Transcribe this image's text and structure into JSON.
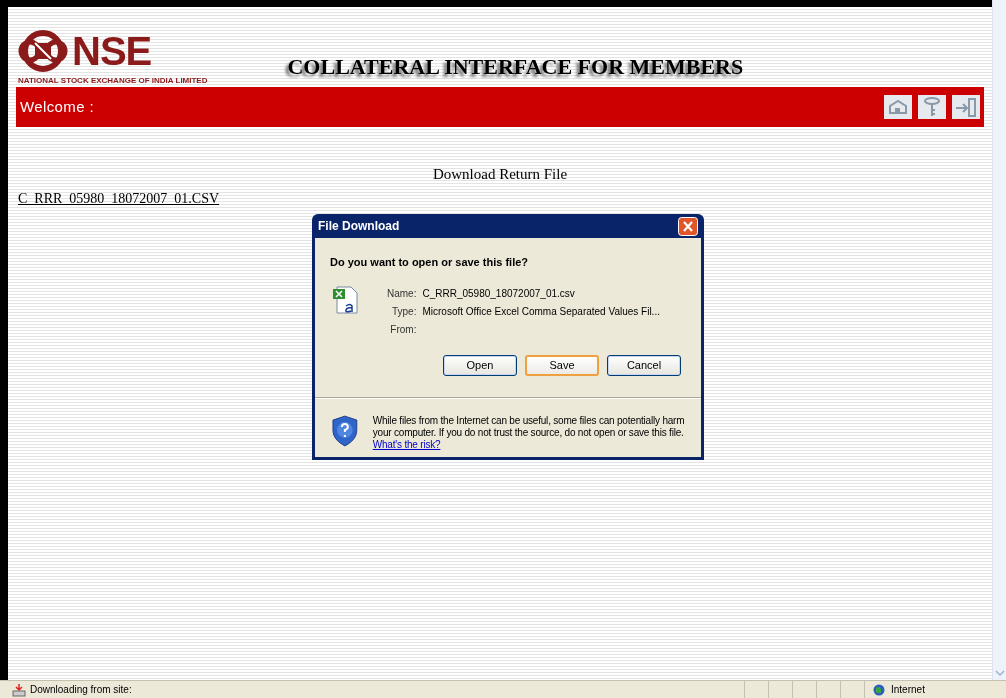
{
  "logo": {
    "name": "NSE",
    "subtitle": "NATIONAL STOCK EXCHANGE OF INDIA LIMITED"
  },
  "title": "COLLATERAL INTERFACE FOR MEMBERS",
  "nav_bar": {
    "welcome": "Welcome :"
  },
  "heading": "Download Return File",
  "file_link": "C_RRR_05980_18072007_01.CSV",
  "dialog": {
    "title": "File Download",
    "question": "Do you want to open or save this file?",
    "fields": [
      {
        "label": "Name:",
        "value": "C_RRR_05980_18072007_01.csv"
      },
      {
        "label": "Type:",
        "value": "Microsoft Office Excel Comma Separated Values Fil..."
      },
      {
        "label": "From:"
      }
    ],
    "buttons": [
      {
        "label": "Open",
        "focused": false
      },
      {
        "label": "Save",
        "focused": true
      },
      {
        "label": "Cancel",
        "focused": false
      }
    ],
    "warning": "While files from the Internet can be useful, some files can potentially harm your computer. If you do not trust the source, do not open or save this file.",
    "risk_link": "What's the risk?"
  },
  "status_bar": {
    "text": "Downloading from site:",
    "zone": "Internet"
  }
}
